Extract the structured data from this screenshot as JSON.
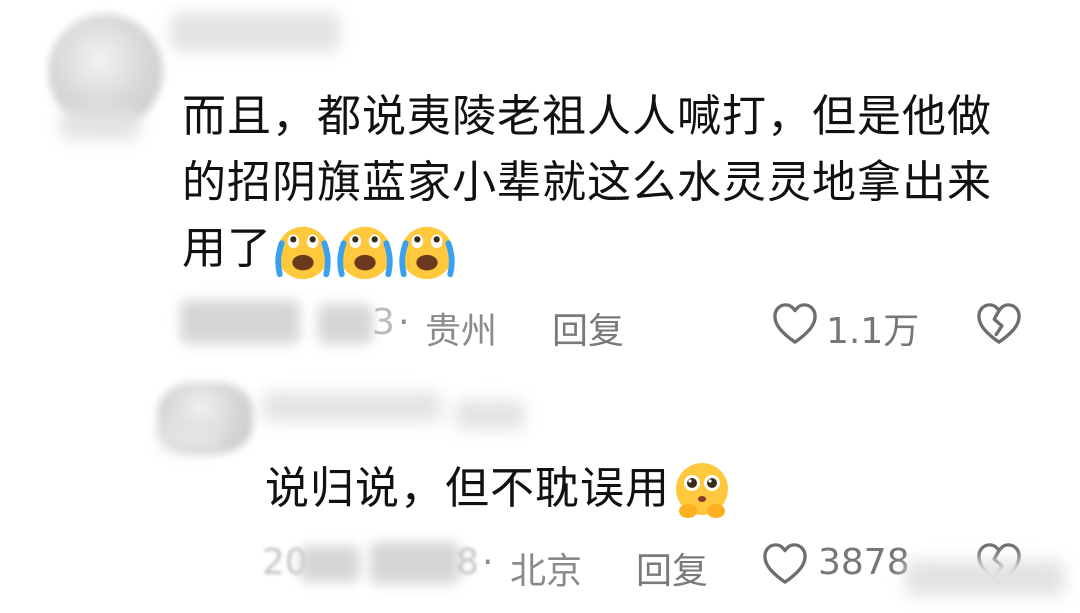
{
  "comments": [
    {
      "text_line1": "而且，都说夷陵老祖人人喊打，但是他做",
      "text_line2": "的招阴旗蓝家小辈就这么水灵灵地拿出来",
      "text_line3": "用了",
      "emoji": "loudly-crying-face-emoji",
      "emoji_count": 3,
      "date_suffix": "3",
      "separator": "·",
      "location": "贵州",
      "reply_label": "回复",
      "like_count": "1.1万"
    },
    {
      "text": "说归说，但不耽误用",
      "emoji": "pleading-face-emoji",
      "date_prefix": "20",
      "date_suffix": "8",
      "separator": "·",
      "location": "北京",
      "reply_label": "回复",
      "like_count": "3878"
    }
  ],
  "icons": {
    "like": "heart-outline-icon",
    "dislike": "broken-heart-icon"
  },
  "colors": {
    "text": "#111111",
    "meta": "#8a8a8a",
    "icon": "#6e6e6e",
    "emoji_yellow": "#ffc83d",
    "emoji_tear": "#3aa0f0"
  }
}
